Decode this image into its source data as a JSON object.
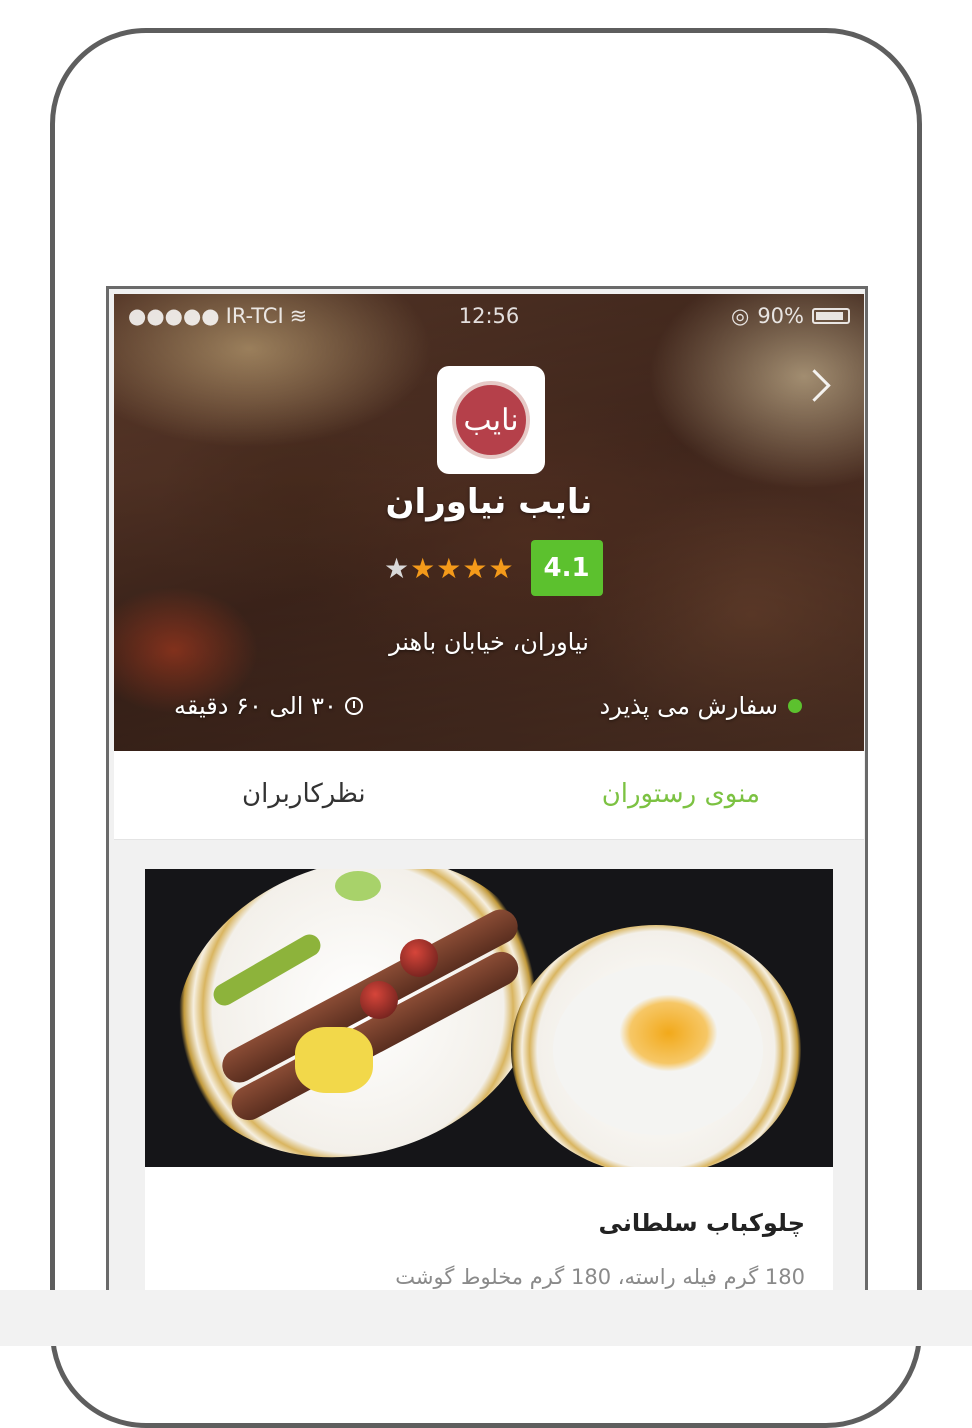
{
  "status_bar": {
    "carrier": "IR-TCI",
    "time": "12:56",
    "battery": "90%"
  },
  "restaurant": {
    "name": "نایب نیاوران",
    "logo_text": "نایب",
    "rating": "4.1",
    "rating_value": 4.1,
    "rating_max": 5,
    "address": "نیاوران، خیابان باهنر",
    "order_status": "سفارش می پذیرد",
    "delivery_time": "۳۰ الی ۶۰ دقیقه"
  },
  "tabs": {
    "menu": "منوی رستوران",
    "reviews": "نظرکاربران"
  },
  "menu_item": {
    "title": "چلوکباب سلطانی",
    "description": "180 گرم فیله راسته، 180 گرم مخلوط گوشت"
  },
  "colors": {
    "accent_green": "#7cc242",
    "rating_badge": "#5cc12e",
    "star": "#f49a1a"
  }
}
